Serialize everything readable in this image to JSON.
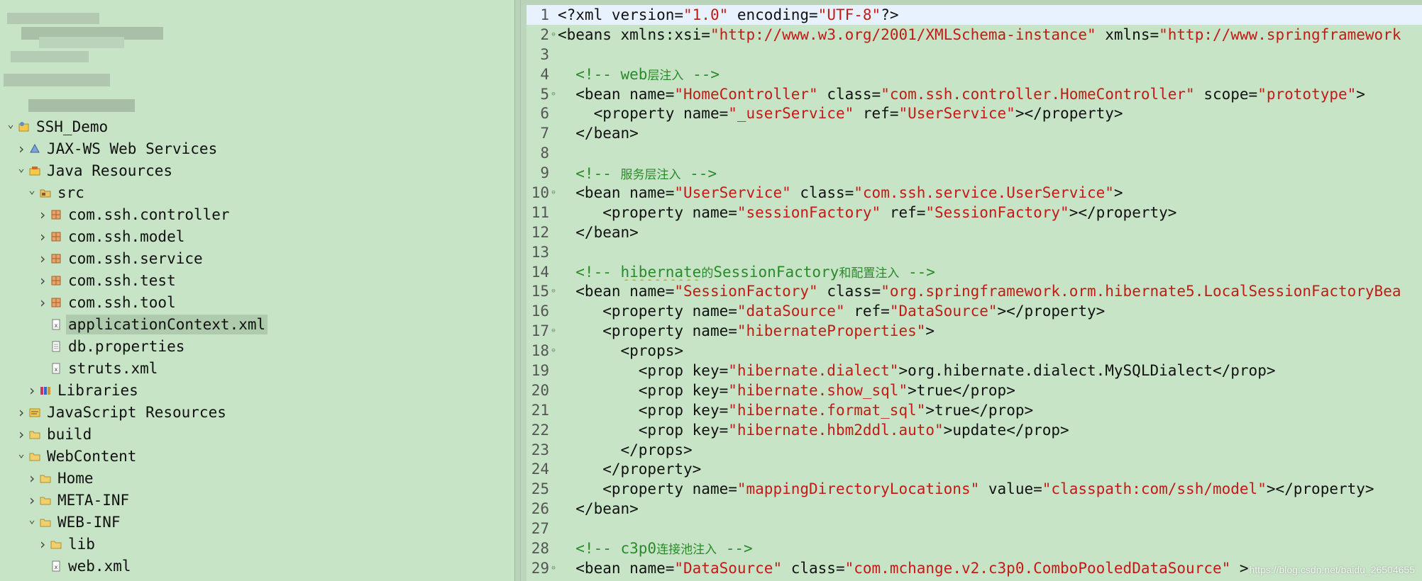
{
  "colors": {
    "background": "#c7e4c7",
    "tag": "#111111",
    "string": "#c41a16",
    "comment": "#2a8a2a",
    "current_line": "#e8f2fe",
    "selection": "#aecbad"
  },
  "explorer": {
    "tree": [
      {
        "label": "SSH_Demo",
        "depth": 0,
        "expanded": true,
        "icon": "project-icon"
      },
      {
        "label": "JAX-WS Web Services",
        "depth": 1,
        "expanded": false,
        "icon": "web-services-icon"
      },
      {
        "label": "Java Resources",
        "depth": 1,
        "expanded": true,
        "icon": "java-resources-icon"
      },
      {
        "label": "src",
        "depth": 2,
        "expanded": true,
        "icon": "source-folder-icon"
      },
      {
        "label": "com.ssh.controller",
        "depth": 3,
        "expanded": false,
        "icon": "package-icon"
      },
      {
        "label": "com.ssh.model",
        "depth": 3,
        "expanded": false,
        "icon": "package-icon"
      },
      {
        "label": "com.ssh.service",
        "depth": 3,
        "expanded": false,
        "icon": "package-icon"
      },
      {
        "label": "com.ssh.test",
        "depth": 3,
        "expanded": false,
        "icon": "package-icon"
      },
      {
        "label": "com.ssh.tool",
        "depth": 3,
        "expanded": false,
        "icon": "package-icon"
      },
      {
        "label": "applicationContext.xml",
        "depth": 3,
        "leaf": true,
        "selected": true,
        "icon": "xml-file-icon"
      },
      {
        "label": "db.properties",
        "depth": 3,
        "leaf": true,
        "icon": "properties-file-icon"
      },
      {
        "label": "struts.xml",
        "depth": 3,
        "leaf": true,
        "icon": "xml-file-icon"
      },
      {
        "label": "Libraries",
        "depth": 2,
        "expanded": false,
        "icon": "libraries-icon"
      },
      {
        "label": "JavaScript Resources",
        "depth": 1,
        "expanded": false,
        "icon": "javascript-resources-icon"
      },
      {
        "label": "build",
        "depth": 1,
        "expanded": false,
        "icon": "folder-icon"
      },
      {
        "label": "WebContent",
        "depth": 1,
        "expanded": true,
        "icon": "folder-icon"
      },
      {
        "label": "Home",
        "depth": 2,
        "expanded": false,
        "icon": "folder-icon"
      },
      {
        "label": "META-INF",
        "depth": 2,
        "expanded": false,
        "icon": "folder-icon"
      },
      {
        "label": "WEB-INF",
        "depth": 2,
        "expanded": true,
        "icon": "folder-icon"
      },
      {
        "label": "lib",
        "depth": 3,
        "expanded": false,
        "icon": "folder-icon"
      },
      {
        "label": "web.xml",
        "depth": 3,
        "leaf": true,
        "icon": "xml-file-icon"
      }
    ]
  },
  "editor": {
    "lines": [
      {
        "n": "1",
        "current": true,
        "tokens": [
          [
            "tag",
            "<?xml "
          ],
          [
            "attr",
            "version="
          ],
          [
            "str",
            "\"1.0\""
          ],
          [
            "attr",
            " encoding="
          ],
          [
            "str",
            "\"UTF-8\""
          ],
          [
            "tag",
            "?>"
          ]
        ]
      },
      {
        "n": "2",
        "fold": true,
        "tokens": [
          [
            "tag",
            "<beans "
          ],
          [
            "attr",
            "xmlns:xsi="
          ],
          [
            "str",
            "\"http://www.w3.org/2001/XMLSchema-instance\""
          ],
          [
            "attr",
            " xmlns="
          ],
          [
            "str",
            "\"http://www.springframework"
          ]
        ]
      },
      {
        "n": "3",
        "tokens": []
      },
      {
        "n": "4",
        "tokens": [
          [
            "cmt",
            "  <!-- web"
          ],
          [
            "cmtcjk",
            "层注入"
          ],
          [
            "cmt",
            " -->"
          ]
        ]
      },
      {
        "n": "5",
        "fold": true,
        "tokens": [
          [
            "tag",
            "  <bean "
          ],
          [
            "attr",
            "name="
          ],
          [
            "str",
            "\"HomeController\""
          ],
          [
            "attr",
            " class="
          ],
          [
            "str",
            "\"com.ssh.controller.HomeController\""
          ],
          [
            "attr",
            " scope="
          ],
          [
            "str",
            "\"prototype\""
          ],
          [
            "tag",
            ">"
          ]
        ]
      },
      {
        "n": "6",
        "tokens": [
          [
            "tag",
            "    <property "
          ],
          [
            "attr",
            "name="
          ],
          [
            "str",
            "\"_userService\""
          ],
          [
            "attr",
            " ref="
          ],
          [
            "str",
            "\"UserService\""
          ],
          [
            "tag",
            "></property>"
          ]
        ]
      },
      {
        "n": "7",
        "tokens": [
          [
            "tag",
            "  </bean>"
          ]
        ]
      },
      {
        "n": "8",
        "tokens": []
      },
      {
        "n": "9",
        "tokens": [
          [
            "cmt",
            "  <!-- "
          ],
          [
            "cmtcjk",
            "服务层注入"
          ],
          [
            "cmt",
            " -->"
          ]
        ]
      },
      {
        "n": "10",
        "fold": true,
        "tokens": [
          [
            "tag",
            "  <bean "
          ],
          [
            "attr",
            "name="
          ],
          [
            "str",
            "\"UserService\""
          ],
          [
            "attr",
            " class="
          ],
          [
            "str",
            "\"com.ssh.service.UserService\""
          ],
          [
            "tag",
            ">"
          ]
        ]
      },
      {
        "n": "11",
        "tokens": [
          [
            "tag",
            "     <property "
          ],
          [
            "attr",
            "name="
          ],
          [
            "str",
            "\"sessionFactory\""
          ],
          [
            "attr",
            " ref="
          ],
          [
            "str",
            "\"SessionFactory\""
          ],
          [
            "tag",
            "></property>"
          ]
        ]
      },
      {
        "n": "12",
        "tokens": [
          [
            "tag",
            "  </bean>"
          ]
        ]
      },
      {
        "n": "13",
        "tokens": []
      },
      {
        "n": "14",
        "tokens": [
          [
            "cmt",
            "  <!-- "
          ],
          [
            "spell",
            "hibernate"
          ],
          [
            "cmtcjk",
            "的"
          ],
          [
            "cmt",
            "SessionFactory"
          ],
          [
            "cmtcjk",
            "和配置注入"
          ],
          [
            "cmt",
            " -->"
          ]
        ]
      },
      {
        "n": "15",
        "fold": true,
        "tokens": [
          [
            "tag",
            "  <bean "
          ],
          [
            "attr",
            "name="
          ],
          [
            "str",
            "\"SessionFactory\""
          ],
          [
            "attr",
            " class="
          ],
          [
            "str",
            "\"org.springframework.orm.hibernate5.LocalSessionFactoryBea"
          ]
        ]
      },
      {
        "n": "16",
        "tokens": [
          [
            "tag",
            "     <property "
          ],
          [
            "attr",
            "name="
          ],
          [
            "str",
            "\"dataSource\""
          ],
          [
            "attr",
            " ref="
          ],
          [
            "str",
            "\"DataSource\""
          ],
          [
            "tag",
            "></property>"
          ]
        ]
      },
      {
        "n": "17",
        "fold": true,
        "tokens": [
          [
            "tag",
            "     <property "
          ],
          [
            "attr",
            "name="
          ],
          [
            "str",
            "\"hibernateProperties\""
          ],
          [
            "tag",
            ">"
          ]
        ]
      },
      {
        "n": "18",
        "fold": true,
        "tokens": [
          [
            "tag",
            "       <props>"
          ]
        ]
      },
      {
        "n": "19",
        "tokens": [
          [
            "tag",
            "         <prop "
          ],
          [
            "attr",
            "key="
          ],
          [
            "str",
            "\"hibernate.dialect\""
          ],
          [
            "tag",
            ">"
          ],
          [
            "text",
            "org.hibernate.dialect.MySQLDialect"
          ],
          [
            "tag",
            "</prop>"
          ]
        ]
      },
      {
        "n": "20",
        "tokens": [
          [
            "tag",
            "         <prop "
          ],
          [
            "attr",
            "key="
          ],
          [
            "str",
            "\"hibernate.show_sql\""
          ],
          [
            "tag",
            ">"
          ],
          [
            "text",
            "true"
          ],
          [
            "tag",
            "</prop>"
          ]
        ]
      },
      {
        "n": "21",
        "tokens": [
          [
            "tag",
            "         <prop "
          ],
          [
            "attr",
            "key="
          ],
          [
            "str",
            "\"hibernate.format_sql\""
          ],
          [
            "tag",
            ">"
          ],
          [
            "text",
            "true"
          ],
          [
            "tag",
            "</prop>"
          ]
        ]
      },
      {
        "n": "22",
        "tokens": [
          [
            "tag",
            "         <prop "
          ],
          [
            "attr",
            "key="
          ],
          [
            "str",
            "\"hibernate.hbm2ddl.auto\""
          ],
          [
            "tag",
            ">"
          ],
          [
            "text",
            "update"
          ],
          [
            "tag",
            "</prop>"
          ]
        ]
      },
      {
        "n": "23",
        "tokens": [
          [
            "tag",
            "       </props>"
          ]
        ]
      },
      {
        "n": "24",
        "tokens": [
          [
            "tag",
            "     </property>"
          ]
        ]
      },
      {
        "n": "25",
        "tokens": [
          [
            "tag",
            "     <property "
          ],
          [
            "attr",
            "name="
          ],
          [
            "str",
            "\"mappingDirectoryLocations\""
          ],
          [
            "attr",
            " value="
          ],
          [
            "str",
            "\"classpath:com/ssh/model\""
          ],
          [
            "tag",
            "></property>"
          ]
        ]
      },
      {
        "n": "26",
        "tokens": [
          [
            "tag",
            "  </bean>"
          ]
        ]
      },
      {
        "n": "27",
        "tokens": []
      },
      {
        "n": "28",
        "tokens": [
          [
            "cmt",
            "  <!-- c3p0"
          ],
          [
            "cmtcjk",
            "连接池注入"
          ],
          [
            "cmt",
            " -->"
          ]
        ]
      },
      {
        "n": "29",
        "fold": true,
        "tokens": [
          [
            "tag",
            "  <bean "
          ],
          [
            "attr",
            "name="
          ],
          [
            "str",
            "\"DataSource\""
          ],
          [
            "attr",
            " class="
          ],
          [
            "str",
            "\"com.mchange.v2.c3p0.ComboPooledDataSource\""
          ],
          [
            "tag",
            " >"
          ]
        ]
      }
    ]
  },
  "watermark": "https://blog.csdn.net/baidu_26504655"
}
